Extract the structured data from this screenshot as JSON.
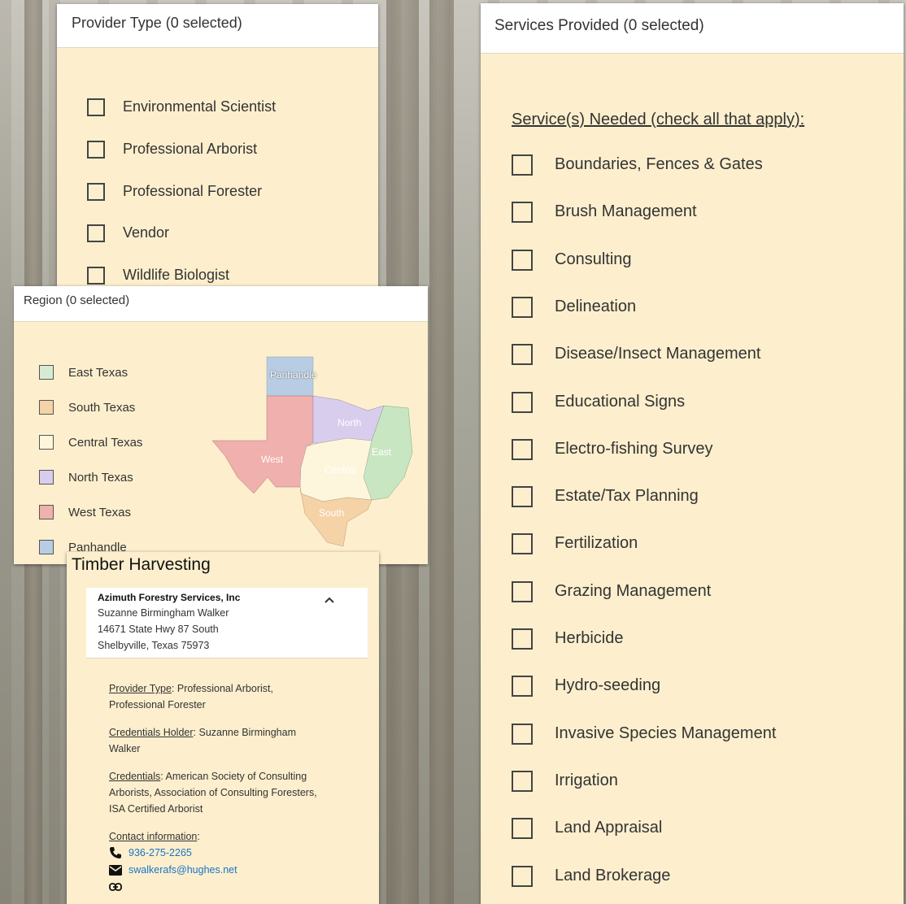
{
  "provider": {
    "header": "Provider Type (0 selected)",
    "options": [
      "Environmental Scientist",
      "Professional Arborist",
      "Professional Forester",
      "Vendor",
      "Wildlife Biologist"
    ]
  },
  "region": {
    "header": "Region (0 selected)",
    "options": [
      {
        "label": "East Texas",
        "color": "#d6ecd2"
      },
      {
        "label": "South Texas",
        "color": "#f5d3a6"
      },
      {
        "label": "Central Texas",
        "color": "#fdf6dc"
      },
      {
        "label": "North Texas",
        "color": "#d9cdee"
      },
      {
        "label": "West Texas",
        "color": "#f0b0ad"
      },
      {
        "label": "Panhandle",
        "color": "#b8cde3"
      }
    ],
    "map_labels": [
      "Panhandle",
      "North",
      "East",
      "West",
      "Central",
      "South"
    ]
  },
  "services": {
    "header": "Services Provided (0 selected)",
    "subheader": "Service(s) Needed (check all that apply):",
    "options": [
      "Boundaries, Fences & Gates",
      "Brush Management",
      "Consulting",
      "Delineation",
      "Disease/Insect Management",
      "Educational Signs",
      "Electro-fishing Survey",
      "Estate/Tax Planning",
      "Fertilization",
      "Grazing Management",
      "Herbicide",
      "Hydro-seeding",
      "Invasive Species Management",
      "Irrigation",
      "Land Appraisal",
      "Land Brokerage"
    ]
  },
  "timber": {
    "title": "Timber Harvesting",
    "company": "Azimuth Forestry Services, Inc",
    "contact_name": "Suzanne Birmingham Walker",
    "address1": "14671 State Hwy 87 South",
    "address2": "Shelbyville, Texas 75973",
    "provider_type_label": "Provider Type",
    "provider_type_value": ": Professional Arborist, Professional Forester",
    "holder_label": "Credentials Holder",
    "holder_value": ": Suzanne Birmingham Walker",
    "credentials_label": "Credentials",
    "credentials_value": ": American Society of Consulting Arborists, Association of Consulting Foresters, ISA Certified Arborist",
    "contact_label": "Contact information",
    "contact_suffix": ":",
    "phone": "936-275-2265",
    "email": "swalkerafs@hughes.net"
  }
}
